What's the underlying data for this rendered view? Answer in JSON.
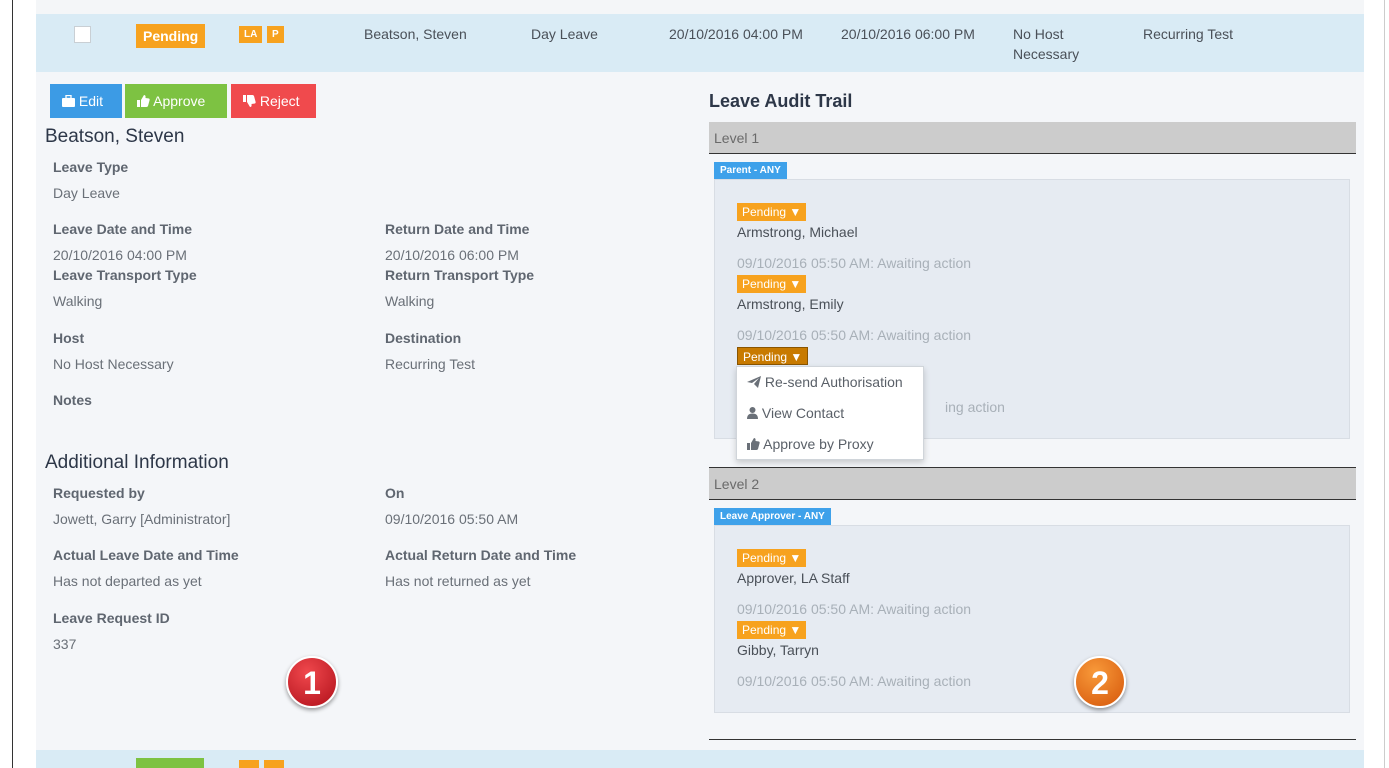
{
  "row": {
    "status": "Pending",
    "tags": [
      "LA",
      "P"
    ],
    "student": "Beatson, Steven",
    "leave_type": "Day Leave",
    "leave_date": "20/10/2016 04:00 PM",
    "return_date": "20/10/2016 06:00 PM",
    "host_line1": "No Host",
    "host_line2": "Necessary",
    "destination": "Recurring Test"
  },
  "actions": {
    "edit": "Edit",
    "approve": "Approve",
    "reject": "Reject"
  },
  "detail": {
    "name": "Beatson, Steven",
    "leave_type_label": "Leave Type",
    "leave_type_value": "Day Leave",
    "leave_date_label": "Leave Date and Time",
    "leave_date_value": "20/10/2016 04:00 PM",
    "return_date_label": "Return Date and Time",
    "return_date_value": "20/10/2016 06:00 PM",
    "leave_transport_label": "Leave Transport Type",
    "leave_transport_value": "Walking",
    "return_transport_label": "Return Transport Type",
    "return_transport_value": "Walking",
    "host_label": "Host",
    "host_value": "No Host Necessary",
    "destination_label": "Destination",
    "destination_value": "Recurring Test",
    "notes_label": "Notes"
  },
  "additional": {
    "heading": "Additional Information",
    "requested_by_label": "Requested by",
    "requested_by_value": "Jowett, Garry [Administrator]",
    "on_label": "On",
    "on_value": "09/10/2016 05:50 AM",
    "actual_leave_label": "Actual Leave Date and Time",
    "actual_leave_value": "Has not departed as yet",
    "actual_return_label": "Actual Return Date and Time",
    "actual_return_value": "Has not returned as yet",
    "request_id_label": "Leave Request ID",
    "request_id_value": "337"
  },
  "audit": {
    "title": "Leave Audit Trail",
    "levels": [
      {
        "label": "Level 1",
        "group": "Parent - ANY",
        "approvers": [
          {
            "status": "Pending",
            "name": "Armstrong, Michael",
            "log": "09/10/2016 05:50 AM: Awaiting action"
          },
          {
            "status": "Pending",
            "name": "Armstrong, Emily",
            "log": "09/10/2016 05:50 AM: Awaiting action"
          },
          {
            "status": "Pending",
            "name": "",
            "log": "ing action"
          }
        ]
      },
      {
        "label": "Level 2",
        "group": "Leave Approver - ANY",
        "approvers": [
          {
            "status": "Pending",
            "name": "Approver, LA Staff",
            "log": "09/10/2016 05:50 AM: Awaiting action"
          },
          {
            "status": "Pending",
            "name": "Gibby, Tarryn",
            "log": "09/10/2016 05:50 AM: Awaiting action"
          }
        ]
      }
    ],
    "dropdown": [
      "Re-send Authorisation",
      "View Contact",
      "Approve by Proxy"
    ]
  },
  "markers": {
    "one": "1",
    "two": "2"
  },
  "colors": {
    "pending": "#f7a21e",
    "edit": "#3c9be5",
    "approve": "#7dc242",
    "reject": "#f04a4d",
    "group_tag": "#3ea1ea",
    "row_highlight": "#d9ebf5"
  },
  "icons": {
    "edit": "briefcase-icon",
    "approve": "thumbs-up-icon",
    "reject": "thumbs-down-icon",
    "caret": "caret-down-icon",
    "resend": "paper-plane-icon",
    "contact": "user-icon",
    "proxy": "thumbs-up-icon"
  }
}
